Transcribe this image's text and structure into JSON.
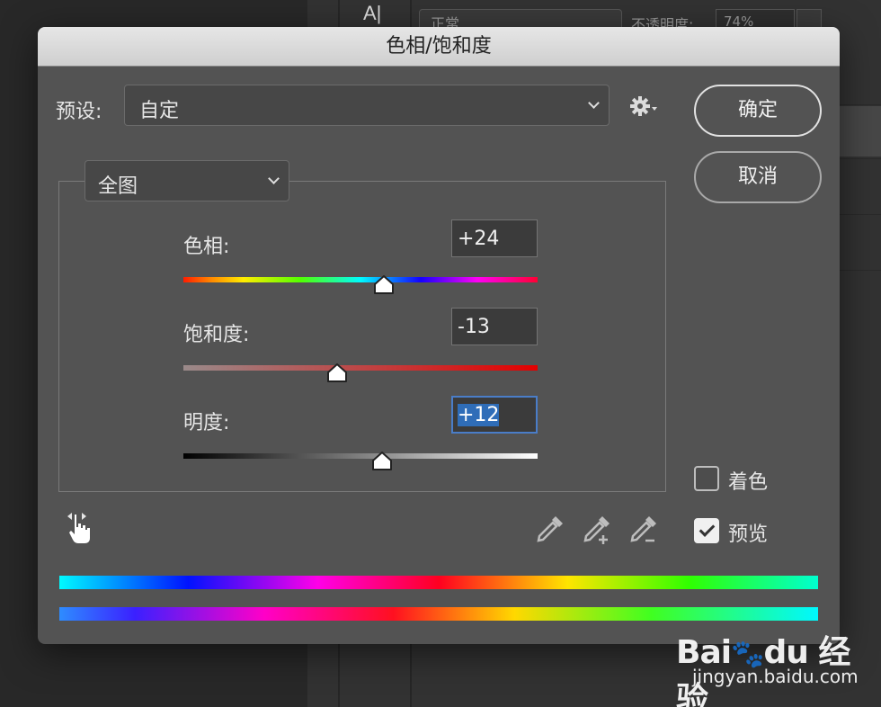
{
  "background": {
    "blend_mode": "正常",
    "opacity_label": "不透明度:",
    "opacity_value": "74%"
  },
  "dialog": {
    "title": "色相/饱和度",
    "preset_label": "预设:",
    "preset_value": "自定",
    "ok_label": "确定",
    "cancel_label": "取消",
    "channel_value": "全图",
    "sliders": {
      "hue": {
        "label": "色相:",
        "value": "+24",
        "level": 24,
        "min": -180,
        "max": 180
      },
      "saturation": {
        "label": "饱和度:",
        "value": "-13",
        "level": -13,
        "min": -100,
        "max": 100
      },
      "lightness": {
        "label": "明度:",
        "value": "+12",
        "level": 12,
        "min": -100,
        "max": 100
      }
    },
    "colorize_label": "着色",
    "colorize_checked": false,
    "preview_label": "预览",
    "preview_checked": true
  },
  "watermark": {
    "logo": "Baidu 经验",
    "url": "jingyan.baidu.com"
  }
}
